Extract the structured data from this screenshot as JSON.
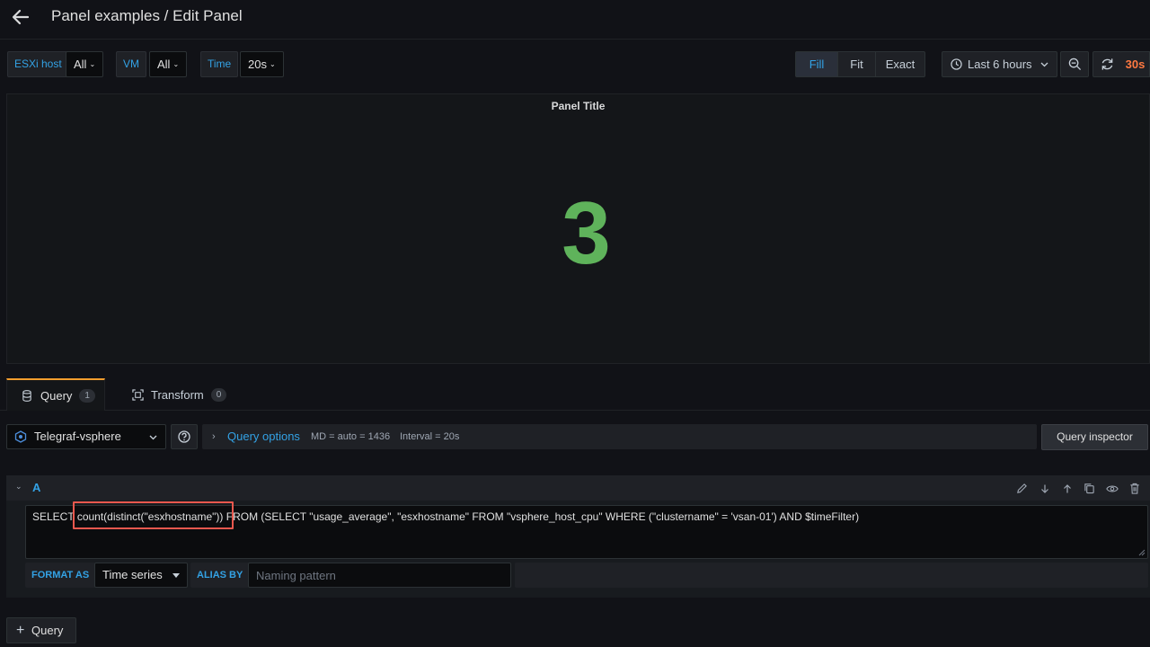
{
  "header": {
    "title": "Panel examples / Edit Panel"
  },
  "variables": [
    {
      "label": "ESXi host",
      "value": "All"
    },
    {
      "label": "VM",
      "value": "All"
    },
    {
      "label": "Time",
      "value": "20s"
    }
  ],
  "view_modes": {
    "fill": "Fill",
    "fit": "Fit",
    "exact": "Exact",
    "selected": "Fill"
  },
  "time_picker": {
    "label": "Last 6 hours"
  },
  "refresh": {
    "interval": "30s"
  },
  "panel": {
    "title": "Panel Title",
    "value": "3",
    "value_color": "#5fb35b"
  },
  "tabs": [
    {
      "label": "Query",
      "count": "1"
    },
    {
      "label": "Transform",
      "count": "0"
    }
  ],
  "query_toolbar": {
    "datasource": "Telegraf-vsphere",
    "options_label": "Query options",
    "md": "MD = auto = 1436",
    "interval": "Interval = 20s",
    "inspector_label": "Query inspector"
  },
  "query": {
    "ref_id": "A",
    "sql_prefix": "SELECT ",
    "sql_highlight": "count(distinct(\"esxhostname\"))",
    "sql_suffix": " FROM (SELECT \"usage_average\", \"esxhostname\" FROM \"vsphere_host_cpu\" WHERE (\"clustername\" = 'vsan-01') AND $timeFilter)",
    "format_as_label": "FORMAT AS",
    "format_as_value": "Time series",
    "alias_by_label": "ALIAS BY",
    "alias_placeholder": "Naming pattern"
  },
  "add_query_label": "Query",
  "colors": {
    "accent": "#33a2e5",
    "highlight_box": "#e8584e",
    "refresh_orange": "#ff7941",
    "tab_active": "#f49d2e"
  }
}
